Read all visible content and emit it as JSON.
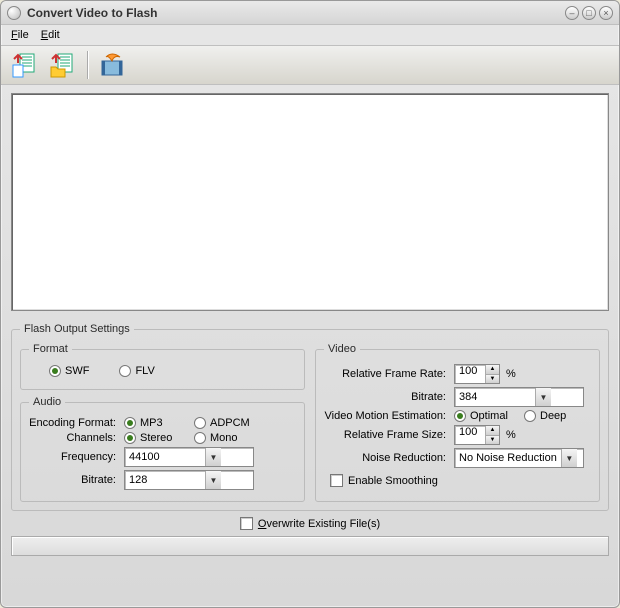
{
  "window": {
    "title": "Convert Video to Flash"
  },
  "menu": {
    "file": "File",
    "edit": "Edit"
  },
  "toolbar": {
    "add_file": "add-file",
    "add_folder": "add-folder",
    "convert": "convert"
  },
  "settings": {
    "legend": "Flash Output Settings",
    "format": {
      "legend": "Format",
      "swf": "SWF",
      "flv": "FLV",
      "selected": "SWF"
    },
    "audio": {
      "legend": "Audio",
      "encoding_label": "Encoding Format:",
      "mp3": "MP3",
      "adpcm": "ADPCM",
      "encoding_selected": "MP3",
      "channels_label": "Channels:",
      "stereo": "Stereo",
      "mono": "Mono",
      "channels_selected": "Stereo",
      "frequency_label": "Frequency:",
      "frequency_value": "44100",
      "bitrate_label": "Bitrate:",
      "bitrate_value": "128"
    },
    "video": {
      "legend": "Video",
      "framerate_label": "Relative Frame Rate:",
      "framerate_value": "100",
      "framerate_unit": "%",
      "bitrate_label": "Bitrate:",
      "bitrate_value": "384",
      "motion_label": "Video Motion Estimation:",
      "optimal": "Optimal",
      "deep": "Deep",
      "motion_selected": "Optimal",
      "framesize_label": "Relative Frame Size:",
      "framesize_value": "100",
      "framesize_unit": "%",
      "noise_label": "Noise Reduction:",
      "noise_value": "No Noise Reduction",
      "smoothing_label": "Enable Smoothing"
    }
  },
  "overwrite": {
    "label_pre": "",
    "label": "Overwrite Existing File(s)"
  }
}
